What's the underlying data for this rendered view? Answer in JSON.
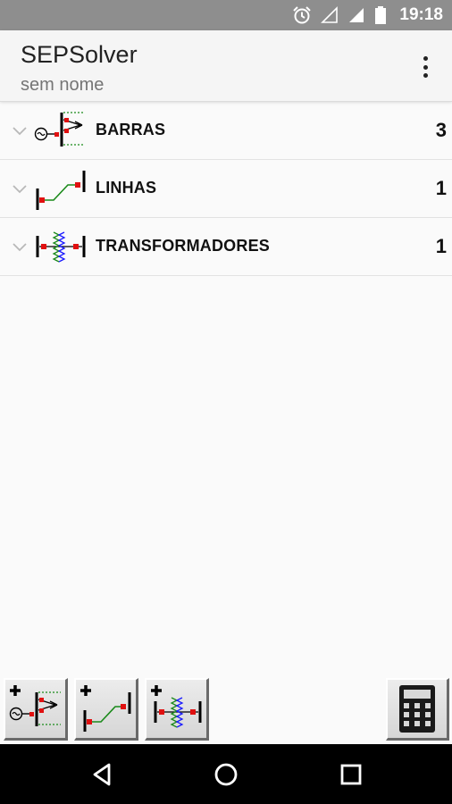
{
  "status_bar": {
    "time": "19:18",
    "icons": [
      "alarm-icon",
      "signal-empty-icon",
      "signal-icon",
      "battery-icon"
    ]
  },
  "app_bar": {
    "title": "SEPSolver",
    "subtitle": "sem nome",
    "menu_icon": "overflow-menu-icon"
  },
  "list": {
    "items": [
      {
        "label": "BARRAS",
        "count": "3",
        "icon": "bus-icon"
      },
      {
        "label": "LINHAS",
        "count": "1",
        "icon": "line-icon"
      },
      {
        "label": "TRANSFORMADORES",
        "count": "1",
        "icon": "transformer-icon"
      }
    ]
  },
  "toolbar": {
    "buttons": [
      "add-bus-icon",
      "add-line-icon",
      "add-transformer-icon",
      "calculator-icon"
    ]
  },
  "nav_bar": {
    "buttons": [
      "back-icon",
      "home-icon",
      "recents-icon"
    ]
  },
  "colors": {
    "status_bar": "#8e8e8e",
    "app_bar": "#f5f5f5",
    "red": "#e01010",
    "green": "#1a8a1a",
    "blue": "#1a1aff"
  }
}
